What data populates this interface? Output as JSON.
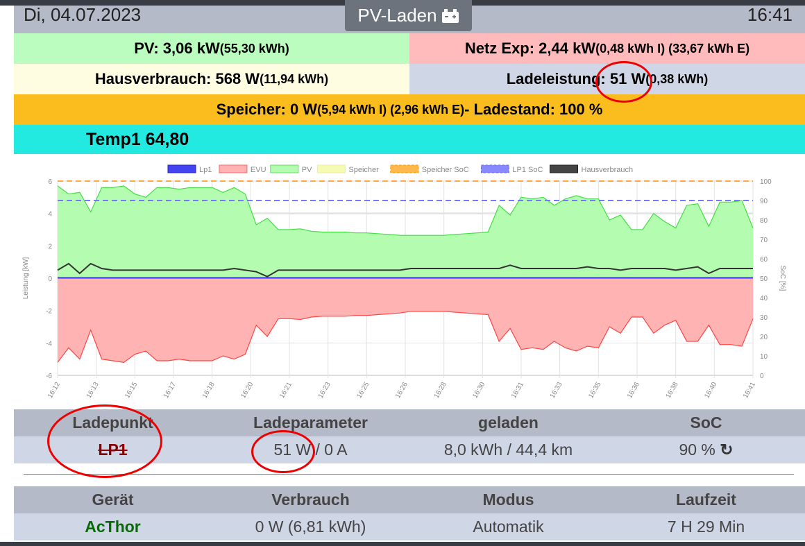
{
  "header": {
    "date": "Di, 04.07.2023",
    "mode": "PV-Laden",
    "mode_icon": "car-battery-icon",
    "time": "16:41"
  },
  "stats": {
    "pv_label": "PV: 3,06 kW",
    "pv_extra": "(55,30 kWh)",
    "netz_label": "Netz Exp: 2,44 kW",
    "netz_extra": "(0,48 kWh I) (33,67 kWh E)",
    "haus_label": "Hausverbrauch: 568 W",
    "haus_extra": "(11,94 kWh)",
    "lade_label": "Ladeleistung: 51 W",
    "lade_extra": "(0,38 kWh)",
    "speicher_label": "Speicher: 0 W",
    "speicher_extra": "(5,94 kWh I) (2,96 kWh E)",
    "speicher_soc": "- Ladestand: 100 %",
    "temp": "Temp1 64,80"
  },
  "colors": {
    "pv": "#bbfdbf",
    "netz": "#ffbbbb",
    "haus": "#fefde1",
    "lade": "#cfd6e6",
    "speicher": "#fbbc1e",
    "temp": "#22eae0"
  },
  "chart_data": {
    "type": "area",
    "legend": [
      "Lp1",
      "EVU",
      "PV",
      "Speicher",
      "Speicher SoC",
      "LP1 SoC",
      "Hausverbrauch"
    ],
    "legend_placement": "top",
    "ylabel": "Leistung [kW]",
    "y2label": "SoC [%]",
    "ylim": [
      -6,
      6
    ],
    "y2lim": [
      0,
      100
    ],
    "yticks": [
      "6",
      "4",
      "2",
      "0",
      "-2",
      "-4",
      "-6"
    ],
    "y2ticks": [
      "100",
      "90",
      "80",
      "70",
      "60",
      "50",
      "40",
      "30",
      "20",
      "10",
      "0"
    ],
    "xticks": [
      "16:12",
      "16:13",
      "16:15",
      "16:17",
      "16:18",
      "16:20",
      "16:21",
      "16:23",
      "16:25",
      "16:26",
      "16:28",
      "16:30",
      "16:31",
      "16:33",
      "16:35",
      "16:36",
      "16:38",
      "16:40",
      "16:41"
    ],
    "series": [
      {
        "name": "PV",
        "values": [
          5.7,
          5.2,
          5.3,
          4.1,
          5.6,
          5.6,
          5.7,
          5.2,
          5.0,
          5.6,
          5.6,
          5.5,
          5.6,
          5.6,
          5.6,
          5.3,
          5.6,
          5.2,
          3.3,
          3.7,
          3.0,
          3.0,
          3.05,
          2.9,
          2.85,
          2.85,
          2.85,
          2.8,
          2.8,
          2.75,
          2.7,
          2.65,
          2.65,
          2.65,
          2.65,
          2.65,
          2.7,
          2.75,
          2.8,
          2.85,
          4.5,
          3.9,
          5.0,
          4.9,
          5.0,
          4.5,
          4.9,
          5.1,
          4.9,
          4.9,
          3.6,
          3.9,
          3.0,
          3.0,
          4.0,
          3.5,
          3.1,
          4.5,
          4.6,
          3.2,
          4.7,
          4.7,
          4.8,
          3.1
        ]
      },
      {
        "name": "EVU",
        "values": [
          -5.2,
          -4.3,
          -5.0,
          -3.2,
          -5.0,
          -5.1,
          -5.2,
          -4.7,
          -4.5,
          -5.1,
          -5.1,
          -5.0,
          -5.1,
          -5.1,
          -5.1,
          -4.8,
          -5.0,
          -4.7,
          -2.9,
          -3.6,
          -2.5,
          -2.5,
          -2.55,
          -2.4,
          -2.35,
          -2.35,
          -2.35,
          -2.3,
          -2.3,
          -2.25,
          -2.2,
          -2.15,
          -2.05,
          -2.05,
          -2.05,
          -2.05,
          -2.1,
          -2.15,
          -2.2,
          -2.25,
          -3.9,
          -3.1,
          -4.4,
          -4.3,
          -4.4,
          -3.9,
          -4.3,
          -4.5,
          -4.2,
          -4.3,
          -3.0,
          -3.4,
          -2.4,
          -2.4,
          -3.4,
          -2.9,
          -2.6,
          -3.9,
          -3.9,
          -2.9,
          -4.1,
          -4.1,
          -4.2,
          -2.5
        ]
      },
      {
        "name": "Hausverbrauch",
        "values": [
          0.5,
          0.9,
          0.3,
          0.9,
          0.6,
          0.5,
          0.5,
          0.5,
          0.5,
          0.5,
          0.5,
          0.5,
          0.5,
          0.5,
          0.5,
          0.5,
          0.6,
          0.5,
          0.4,
          0.1,
          0.5,
          0.5,
          0.5,
          0.5,
          0.5,
          0.5,
          0.5,
          0.5,
          0.5,
          0.5,
          0.5,
          0.5,
          0.6,
          0.6,
          0.6,
          0.6,
          0.6,
          0.6,
          0.6,
          0.6,
          0.6,
          0.8,
          0.6,
          0.6,
          0.6,
          0.6,
          0.6,
          0.6,
          0.7,
          0.6,
          0.6,
          0.5,
          0.6,
          0.6,
          0.6,
          0.6,
          0.5,
          0.6,
          0.7,
          0.3,
          0.6,
          0.6,
          0.6,
          0.6
        ]
      },
      {
        "name": "Lp1",
        "values": [
          0.05,
          0.05
        ]
      },
      {
        "name": "Speicher SoC",
        "soc": 100
      },
      {
        "name": "LP1 SoC",
        "soc": 90
      }
    ]
  },
  "lp_table": {
    "headers": [
      "Ladepunkt",
      "Ladeparameter",
      "geladen",
      "SoC"
    ],
    "row": [
      "LP1",
      "51 W / 0 A",
      "8,0 kWh / 44,4 km",
      "90 %"
    ],
    "refresh_icon": "refresh-icon"
  },
  "dev_table": {
    "headers": [
      "Gerät",
      "Verbrauch",
      "Modus",
      "Laufzeit"
    ],
    "row": [
      "AcThor",
      "0 W (6,81 kWh)",
      "Automatik",
      "7 H 29 Min"
    ]
  }
}
